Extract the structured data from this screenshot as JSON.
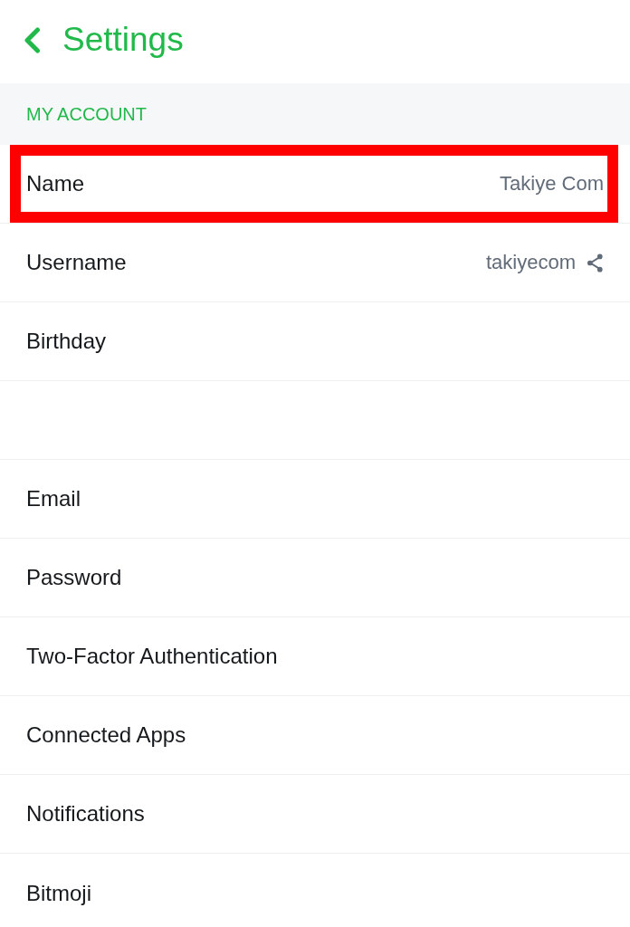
{
  "header": {
    "title": "Settings"
  },
  "section": {
    "title": "MY ACCOUNT"
  },
  "rows": [
    {
      "kind": "value",
      "label": "Name",
      "value": "Takiye Com",
      "highlighted": true
    },
    {
      "kind": "share",
      "label": "Username",
      "value": "takiyecom",
      "highlighted": false
    },
    {
      "kind": "plain",
      "label": "Birthday",
      "highlighted": false
    },
    {
      "kind": "blank",
      "highlighted": false
    },
    {
      "kind": "plain",
      "label": "Email",
      "highlighted": false
    },
    {
      "kind": "plain",
      "label": "Password",
      "highlighted": false
    },
    {
      "kind": "plain",
      "label": "Two-Factor Authentication",
      "highlighted": false
    },
    {
      "kind": "plain",
      "label": "Connected Apps",
      "highlighted": false
    },
    {
      "kind": "plain",
      "label": "Notifications",
      "highlighted": false
    },
    {
      "kind": "plain",
      "label": "Bitmoji",
      "highlighted": false
    }
  ]
}
